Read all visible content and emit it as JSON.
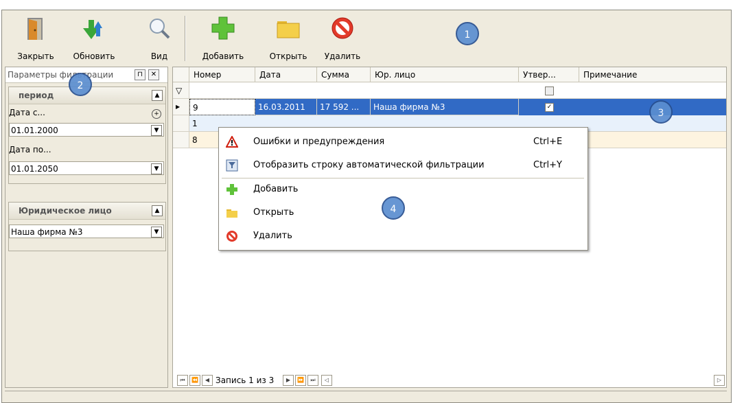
{
  "toolbar": {
    "close_label": "Закрыть",
    "refresh_label": "Обновить",
    "view_label": "Вид",
    "add_label": "Добавить",
    "open_label": "Открыть",
    "delete_label": "Удалить"
  },
  "badges": [
    "1",
    "2",
    "3",
    "4"
  ],
  "filter_panel": {
    "title": "Параметры фильтрации",
    "period_group": {
      "title": "период",
      "date_from_label": "Дата с...",
      "date_from_value": "01.01.2000",
      "date_to_label": "Дата по...",
      "date_to_value": "01.01.2050"
    },
    "entity_group": {
      "title": "Юридическое лицо",
      "value": "Наша фирма №3"
    }
  },
  "grid": {
    "columns": [
      "Номер",
      "Дата",
      "Сумма",
      "Юр. лицо",
      "Утвер...",
      "Примечание"
    ],
    "rows": [
      {
        "number": "9",
        "date": "16.03.2011",
        "sum": "17 592 ...",
        "entity": "Наша фирма №3",
        "approved": true
      },
      {
        "number": "1",
        "date": "",
        "sum": "",
        "entity": "",
        "approved": false
      },
      {
        "number": "8",
        "date": "",
        "sum": "",
        "entity": "",
        "approved": false
      }
    ],
    "record_nav": "Запись 1 из 3"
  },
  "context_menu": {
    "items": [
      {
        "label": "Ошибки и предупреждения",
        "shortcut": "Ctrl+E",
        "icon": "warning-icon"
      },
      {
        "label": "Отобразить строку автоматической фильтрации",
        "shortcut": "Ctrl+Y",
        "icon": "filter-row-icon"
      },
      {
        "label": "Добавить",
        "shortcut": "",
        "icon": "add-icon"
      },
      {
        "label": "Открыть",
        "shortcut": "",
        "icon": "open-folder-icon"
      },
      {
        "label": "Удалить",
        "shortcut": "",
        "icon": "delete-icon"
      }
    ]
  },
  "colors": {
    "selection": "#316ac5",
    "row_alt": "#e8f1fb",
    "badge": "#5b8ed0",
    "window_bg": "#efebde"
  }
}
